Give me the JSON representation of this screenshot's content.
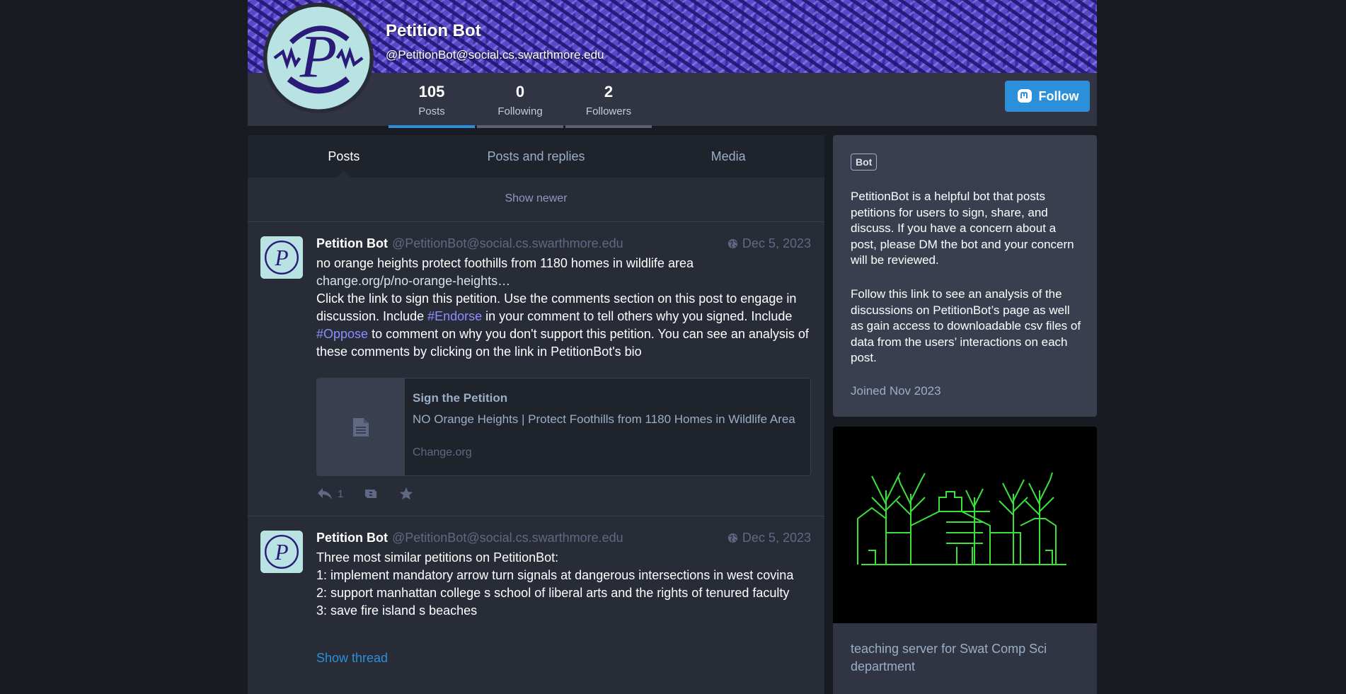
{
  "profile": {
    "display_name": "Petition Bot",
    "handle": "@PetitionBot@social.cs.swarthmore.edu",
    "counters": [
      {
        "value": "105",
        "label": "Posts"
      },
      {
        "value": "0",
        "label": "Following"
      },
      {
        "value": "2",
        "label": "Followers"
      }
    ],
    "follow_label": "Follow",
    "avatar_letter": "P"
  },
  "tabs": [
    "Posts",
    "Posts and replies",
    "Media"
  ],
  "show_newer": "Show newer",
  "posts": [
    {
      "author": "Petition Bot",
      "handle": "@PetitionBot@social.cs.swarthmore.edu",
      "date": "Dec 5, 2023",
      "line1": "no orange heights protect foothills from 1180 homes in wildlife area",
      "link": "change.org/p/no-orange-heights…",
      "p1": "Click the link to sign this petition. Use the comments section on this post to engage in discussion. Include ",
      "tag1": "#Endorse",
      "p2": " in your comment to tell others why you signed. Include ",
      "tag2": "#Oppose",
      "p3": " to comment on why you don't support this petition. You can see an analysis of these comments by clicking on the link in PetitionBot's bio",
      "card": {
        "title": "Sign the Petition",
        "description": "NO Orange Heights | Protect Foothills from 1180 Homes in Wildlife Area",
        "provider": "Change.org"
      },
      "reply_count": "1"
    },
    {
      "author": "Petition Bot",
      "handle": "@PetitionBot@social.cs.swarthmore.edu",
      "date": "Dec 5, 2023",
      "l1": "Three most similar petitions on PetitionBot:",
      "l2": "1: implement mandatory arrow turn signals at dangerous intersections in west covina",
      "l3": "2: support manhattan college s school of liberal arts and the rights of tenured faculty",
      "l4": "3: save fire island s beaches",
      "show_thread": "Show thread"
    }
  ],
  "sidebar": {
    "badge": "Bot",
    "bio1": "PetitionBot is a helpful bot that posts petitions for users to sign, share, and discuss. If you have a concern about a post, please DM the bot and your concern will be reviewed.",
    "bio2": "Follow this link to see an analysis of the discussions on PetitionBot’s page as well as gain access to downloadable csv files of data from the users’ interactions on each post.",
    "joined": "Joined Nov 2023",
    "server_description": "teaching server for Swat Comp Sci department"
  },
  "colors": {
    "accent": "#2b90d9",
    "background": "#191b22",
    "panel": "#282c37",
    "hashtag": "#8c8dff",
    "server_art": "#39e13a"
  }
}
